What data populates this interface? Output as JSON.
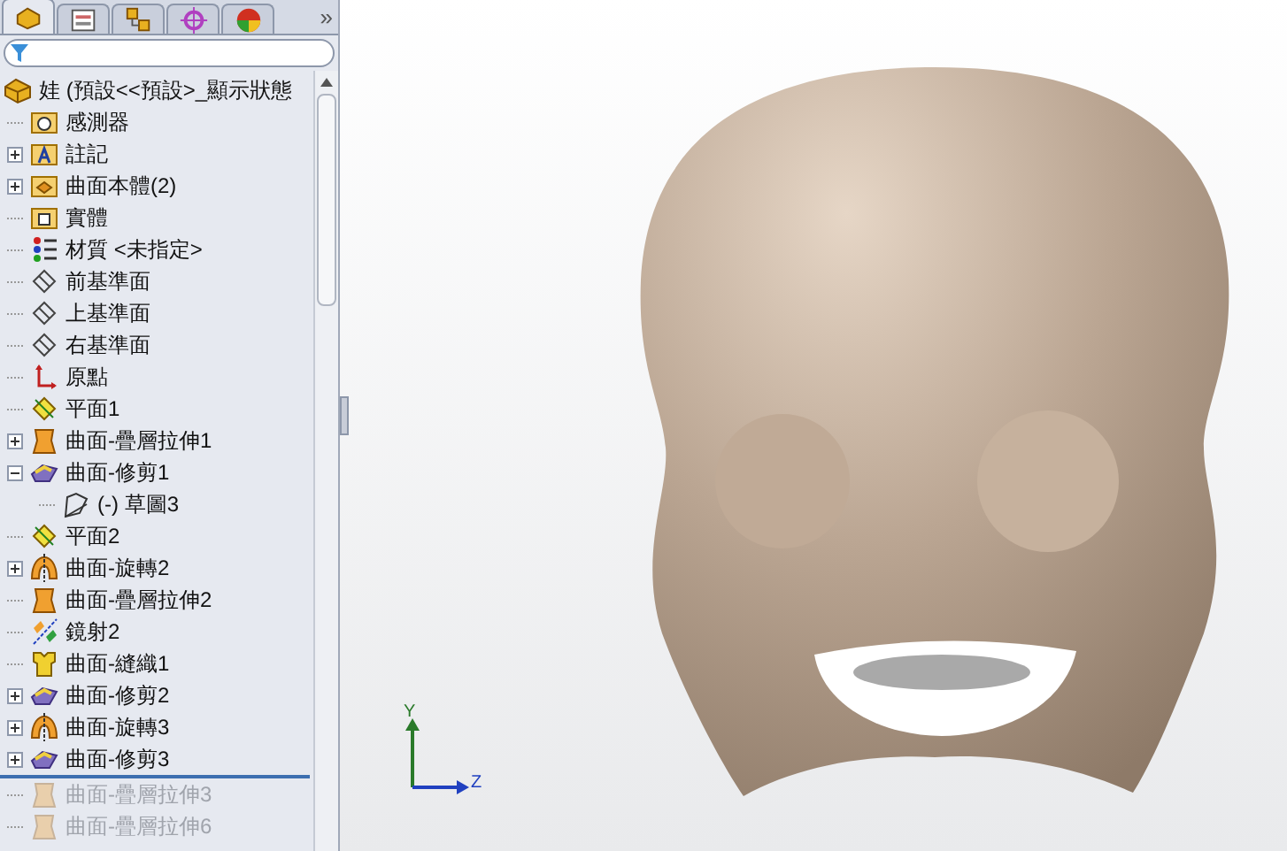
{
  "tabs": [
    {
      "kind": "feature",
      "selected": true
    },
    {
      "kind": "property",
      "selected": false
    },
    {
      "kind": "config",
      "selected": false
    },
    {
      "kind": "dimxpert",
      "selected": false
    },
    {
      "kind": "display",
      "selected": false
    }
  ],
  "overflow_button": "»",
  "tree": {
    "label": "娃 (預設<<預設>_顯示狀態",
    "kind": "part",
    "children": [
      {
        "label": "感測器",
        "kind": "sensor-folder",
        "rolled_back": false
      },
      {
        "label": "註記",
        "kind": "annotation-folder",
        "expanded": false,
        "rolled_back": false
      },
      {
        "label": "曲面本體(2)",
        "kind": "surface-folder",
        "expanded": false,
        "rolled_back": false
      },
      {
        "label": "實體",
        "kind": "solid-folder",
        "rolled_back": false
      },
      {
        "label": "材質 <未指定>",
        "kind": "material",
        "rolled_back": false
      },
      {
        "label": "前基準面",
        "kind": "plane",
        "rolled_back": false
      },
      {
        "label": "上基準面",
        "kind": "plane",
        "rolled_back": false
      },
      {
        "label": "右基準面",
        "kind": "plane",
        "rolled_back": false
      },
      {
        "label": "原點",
        "kind": "origin",
        "rolled_back": false
      },
      {
        "label": "平面1",
        "kind": "ref-plane",
        "rolled_back": false
      },
      {
        "label": "曲面-疊層拉伸1",
        "kind": "loft",
        "expanded": false,
        "rolled_back": false
      },
      {
        "label": "曲面-修剪1",
        "kind": "trim",
        "expanded": true,
        "rolled_back": false,
        "children": [
          {
            "label": "(-) 草圖3",
            "kind": "sketch",
            "rolled_back": false
          }
        ]
      },
      {
        "label": "平面2",
        "kind": "ref-plane",
        "rolled_back": false
      },
      {
        "label": "曲面-旋轉2",
        "kind": "revolve",
        "expanded": false,
        "rolled_back": false
      },
      {
        "label": "曲面-疊層拉伸2",
        "kind": "loft",
        "rolled_back": false
      },
      {
        "label": "鏡射2",
        "kind": "mirror",
        "rolled_back": false
      },
      {
        "label": "曲面-縫織1",
        "kind": "knit",
        "rolled_back": false
      },
      {
        "label": "曲面-修剪2",
        "kind": "trim",
        "expanded": false,
        "rolled_back": false
      },
      {
        "label": "曲面-旋轉3",
        "kind": "revolve",
        "expanded": false,
        "rolled_back": false
      },
      {
        "label": "曲面-修剪3",
        "kind": "trim",
        "expanded": false,
        "rolled_back": false
      },
      {
        "label": "曲面-疊層拉伸3",
        "kind": "loft",
        "rolled_back": true
      },
      {
        "label": "曲面-疊層拉伸6",
        "kind": "loft",
        "rolled_back": true
      }
    ]
  },
  "triad": {
    "y_label": "Y",
    "z_label": "Z"
  }
}
